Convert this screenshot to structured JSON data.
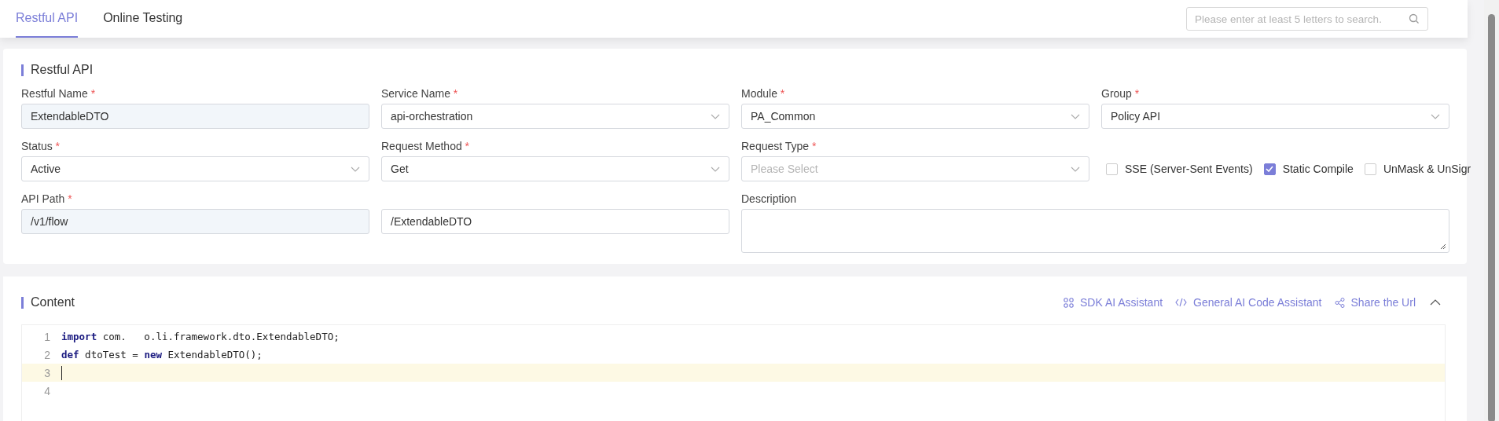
{
  "tabs": [
    {
      "label": "Restful API",
      "selected": true
    },
    {
      "label": "Online Testing",
      "selected": false
    }
  ],
  "search": {
    "placeholder": "Please enter at least 5 letters to search."
  },
  "restful_api": {
    "title": "Restful API",
    "fields": [
      {
        "kind": "input",
        "label": "Restful Name",
        "required_mark": "*",
        "value": "ExtendableDTO",
        "disabled": true
      },
      {
        "kind": "select",
        "label": "Service Name",
        "required_mark": "*",
        "value": "api-orchestration"
      },
      {
        "kind": "select",
        "label": "Module",
        "required_mark": "*",
        "value": "PA_Common"
      },
      {
        "kind": "select",
        "label": "Group",
        "required_mark": "*",
        "value": "Policy API"
      },
      {
        "kind": "select",
        "label": "Status",
        "required_mark": "*",
        "value": "Active"
      },
      {
        "kind": "select",
        "label": "Request Method",
        "required_mark": "*",
        "value": "Get"
      },
      {
        "kind": "select",
        "label": "Request Type",
        "required_mark": "*",
        "placeholder": "Please Select"
      },
      {
        "kind": "checkboxes",
        "options": [
          {
            "label": "SSE (Server-Sent Events)",
            "checked": false
          },
          {
            "label": "Static Compile",
            "checked": true
          },
          {
            "label": "UnMask & UnSigr",
            "checked": false
          }
        ]
      },
      {
        "kind": "input",
        "label": "API Path",
        "required_mark": "*",
        "value": "/v1/flow",
        "disabled": true
      },
      {
        "kind": "input",
        "value": "/ExtendableDTO",
        "disabled": false
      },
      {
        "kind": "textarea",
        "label": "Description"
      }
    ]
  },
  "content": {
    "title": "Content",
    "actions": [
      {
        "kind": "sdk",
        "label": "SDK AI Assistant"
      },
      {
        "kind": "code",
        "label": "General AI Code Assistant"
      },
      {
        "kind": "share",
        "label": "Share the Url"
      }
    ],
    "expanded": true,
    "code_lines": [
      {
        "number": "1",
        "tokens": [
          {
            "kind": "keyword",
            "text": "import"
          },
          {
            "kind": "plain",
            "text": " com.   o.li.framework.dto.ExtendableDTO;"
          }
        ],
        "current": false
      },
      {
        "number": "2",
        "tokens": [
          {
            "kind": "keyword",
            "text": "def"
          },
          {
            "kind": "plain",
            "text": " dtoTest = "
          },
          {
            "kind": "keyword",
            "text": "new"
          },
          {
            "kind": "plain",
            "text": " ExtendableDTO();"
          }
        ],
        "current": false
      },
      {
        "number": "3",
        "current": true
      },
      {
        "number": "4",
        "current": false
      }
    ]
  }
}
